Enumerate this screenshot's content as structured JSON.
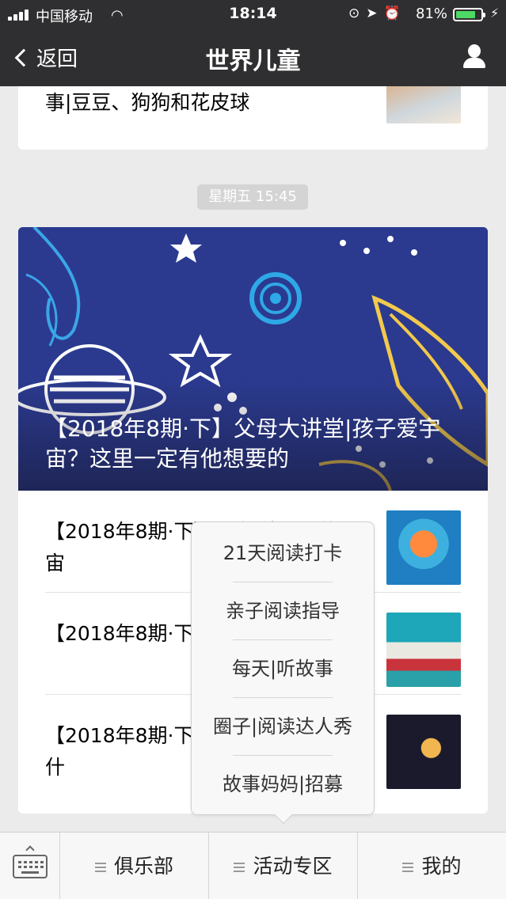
{
  "status_bar": {
    "carrier": "中国移动",
    "time": "18:14",
    "battery_percent": "81%",
    "battery_level": 0.81
  },
  "nav": {
    "back_label": "返回",
    "title": "世界儿童"
  },
  "feed": {
    "prev_card_text": "事|豆豆、狗狗和花皮球",
    "timestamp": "星期五 15:45",
    "cover_title": "【2018年8期·下】父母大讲堂|孩子爱宇宙？这里一定有他想要的",
    "rows": [
      {
        "text": "【2018年8期·下】…事|外星人的宇宙"
      },
      {
        "text": "【2018年8期·下】…事|走！去太空"
      },
      {
        "text": "【2018年8期·下】…事|宇宙里面有什"
      }
    ]
  },
  "popup_menu": {
    "items": [
      "21天阅读打卡",
      "亲子阅读指导",
      "每天|听故事",
      "圈子|阅读达人秀",
      "故事妈妈|招募"
    ]
  },
  "bottom_menu": {
    "tabs": [
      "俱乐部",
      "活动专区",
      "我的"
    ]
  },
  "colors": {
    "nav_bg": "#2f2f31",
    "cover_bg": "#2b3a8f",
    "battery_green": "#4cd964"
  },
  "icons": [
    "signal-icon",
    "wifi-icon",
    "battery-icon",
    "back-chevron-icon",
    "user-icon",
    "keyboard-icon",
    "menu-lines-icon"
  ]
}
